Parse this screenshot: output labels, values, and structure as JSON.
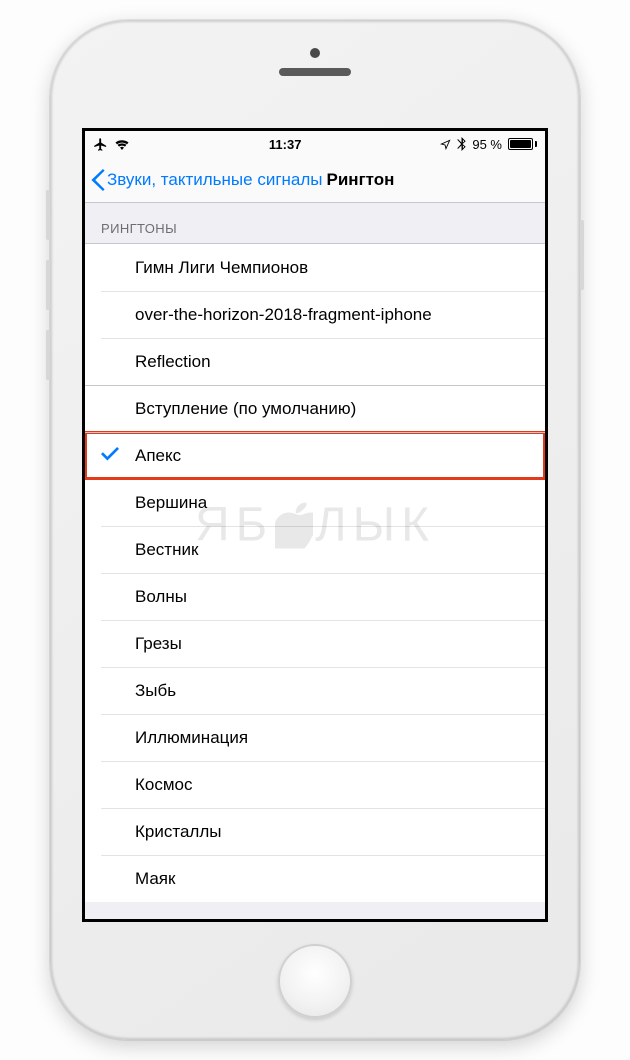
{
  "status": {
    "time": "11:37",
    "battery_pct": "95 %"
  },
  "nav": {
    "back_label": "Звуки, тактильные сигналы",
    "title": "Рингтон"
  },
  "section": {
    "header": "РИНГТОНЫ"
  },
  "ringtones": {
    "custom": [
      {
        "label": "Гимн Лиги Чемпионов"
      },
      {
        "label": "over-the-horizon-2018-fragment-iphone"
      },
      {
        "label": "Reflection"
      }
    ],
    "default_label": "Вступление (по умолчанию)",
    "system": [
      {
        "label": "Апекс",
        "selected": true
      },
      {
        "label": "Вершина"
      },
      {
        "label": "Вестник"
      },
      {
        "label": "Волны"
      },
      {
        "label": "Грезы"
      },
      {
        "label": "Зыбь"
      },
      {
        "label": "Иллюминация"
      },
      {
        "label": "Космос"
      },
      {
        "label": "Кристаллы"
      },
      {
        "label": "Маяк"
      }
    ]
  },
  "watermark": {
    "left": "ЯБ",
    "right": "ЛЫК"
  }
}
